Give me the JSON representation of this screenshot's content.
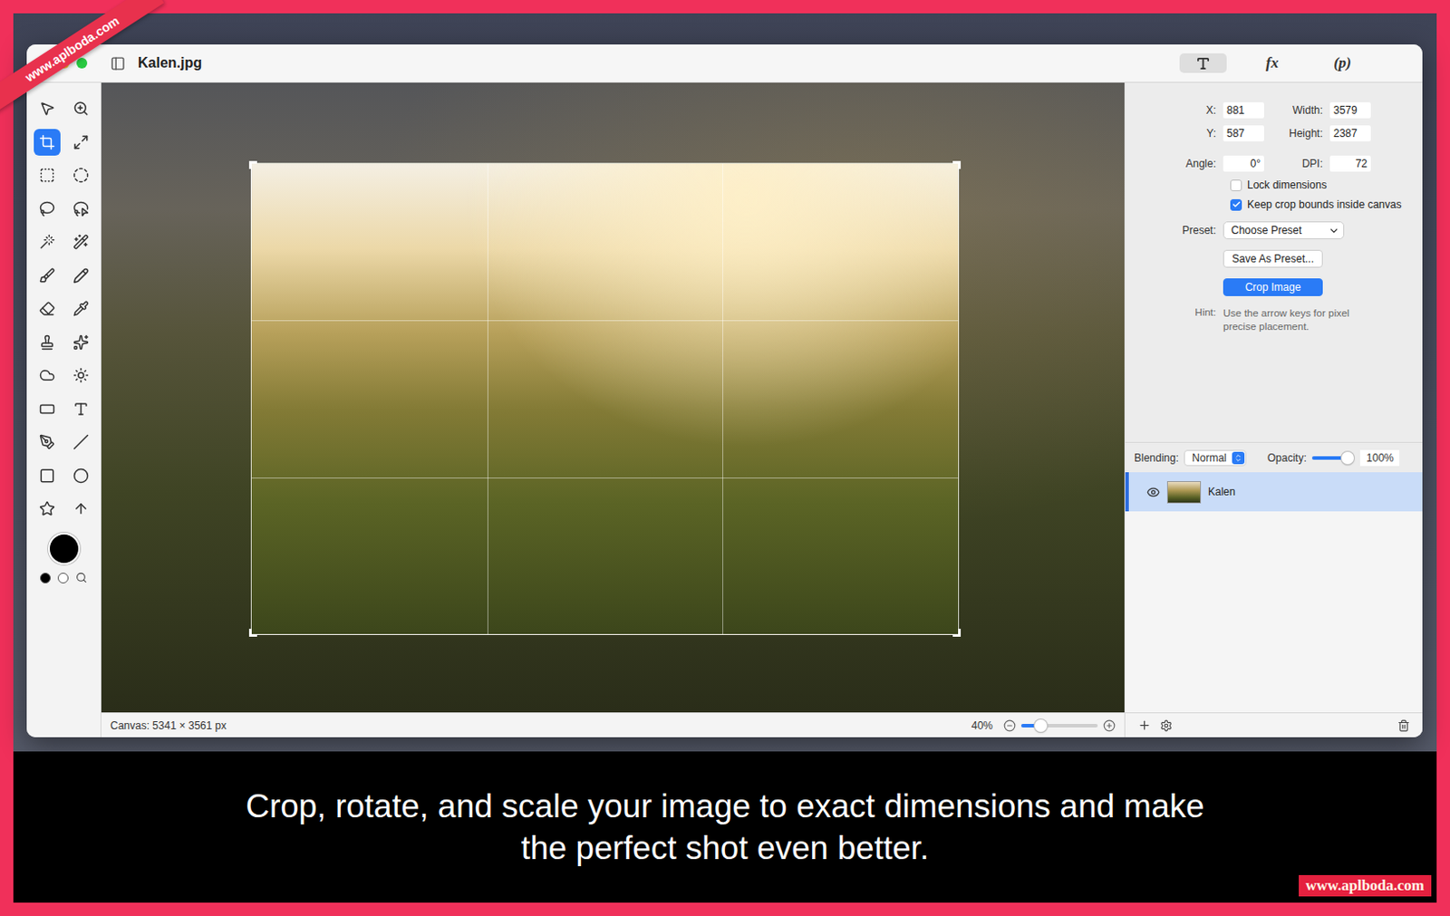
{
  "window": {
    "title": "Kalen.jpg"
  },
  "inspector_tabs": [
    {
      "kind": "icon",
      "label": "",
      "selected": true
    },
    {
      "kind": "text",
      "label": "fx",
      "selected": false
    },
    {
      "kind": "text",
      "label": "(p)",
      "selected": false
    }
  ],
  "tools": [
    {
      "selected": false
    },
    {
      "selected": false
    },
    {
      "selected": true
    },
    {
      "selected": false
    },
    {
      "selected": false
    },
    {
      "selected": false
    },
    {
      "selected": false
    },
    {
      "selected": false
    },
    {
      "selected": false
    },
    {
      "selected": false
    },
    {
      "selected": false
    },
    {
      "selected": false
    },
    {
      "selected": false
    },
    {
      "selected": false
    },
    {
      "selected": false
    },
    {
      "selected": false
    },
    {
      "selected": false
    },
    {
      "selected": false
    },
    {
      "selected": false
    },
    {
      "selected": false
    },
    {
      "selected": false
    },
    {
      "selected": false
    },
    {
      "selected": false
    },
    {
      "selected": false
    },
    {
      "selected": false
    },
    {
      "selected": false
    }
  ],
  "crop_fields": [
    {
      "label": "X:",
      "value": "881"
    },
    {
      "label": "Width:",
      "value": "3579"
    },
    {
      "label": "Y:",
      "value": "587"
    },
    {
      "label": "Height:",
      "value": "2387"
    },
    {
      "label": "Angle:",
      "value": "0°"
    },
    {
      "label": "DPI:",
      "value": "72"
    }
  ],
  "options": [
    {
      "label": "Lock dimensions",
      "checked": false
    },
    {
      "label": "Keep crop bounds inside canvas",
      "checked": true
    }
  ],
  "preset": {
    "label": "Preset:",
    "value": "Choose Preset"
  },
  "buttons": [
    {
      "label": "Save As Preset...",
      "primary": false
    },
    {
      "label": "Crop Image",
      "primary": true
    }
  ],
  "hint": {
    "label": "Hint:",
    "text": "Use the arrow keys for pixel precise placement."
  },
  "layer_controls": {
    "blending_label": "Blending:",
    "blending": "Normal",
    "opacity_label": "Opacity:",
    "opacity": {
      "level": 1,
      "reading": "100%"
    }
  },
  "layers": [
    {
      "name": "Kalen",
      "visible": true,
      "selected": true
    }
  ],
  "status_bar": {
    "canvas": "Canvas: 5341 × 3561 px",
    "zoom": "40%",
    "zoom_level": 0.25
  },
  "caption": "Crop, rotate, and scale your image to exact dimensions and make the perfect shot even better.",
  "watermarks": {
    "ribbon": "www.aplboda.com",
    "badge": "www.aplboda.com"
  }
}
